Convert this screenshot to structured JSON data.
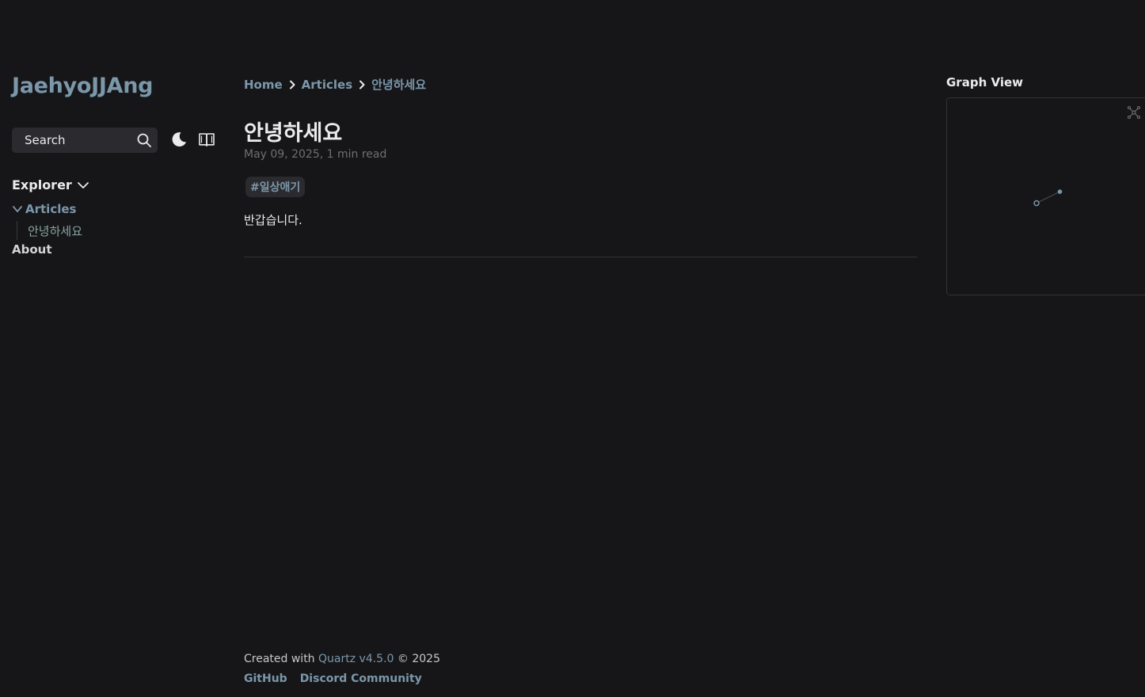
{
  "site": {
    "title": "JaehyoJJAng"
  },
  "search": {
    "placeholder": "Search"
  },
  "icons": {
    "search": "search-icon",
    "darkmode": "moon-icon",
    "reader": "book-icon",
    "explorer_toggle": "chevron-down-icon",
    "folder_toggle": "chevron-down-icon",
    "breadcrumb_sep": "chevron-right-icon",
    "global_graph": "global-graph-icon"
  },
  "explorer": {
    "title": "Explorer",
    "folder": "Articles",
    "files": [
      "안녕하세요"
    ],
    "about": "About"
  },
  "breadcrumb": {
    "home": "Home",
    "articles": "Articles",
    "current": "안녕하세요"
  },
  "article": {
    "title": "안녕하세요",
    "meta": "May 09, 2025,  1 min read",
    "tag": "#일상애기",
    "body": "반갑습니다."
  },
  "graph": {
    "title": "Graph View"
  },
  "footer": {
    "created_prefix": "Created with",
    "quartz_link": "Quartz v4.5.0",
    "created_suffix": "© 2025",
    "links": [
      "GitHub",
      "Discord Community"
    ]
  },
  "colors": {
    "background": "#161618",
    "accent": "#7b97aa",
    "secondary": "#84a59d",
    "text": "#ebebec",
    "muted": "#6f6f73"
  }
}
